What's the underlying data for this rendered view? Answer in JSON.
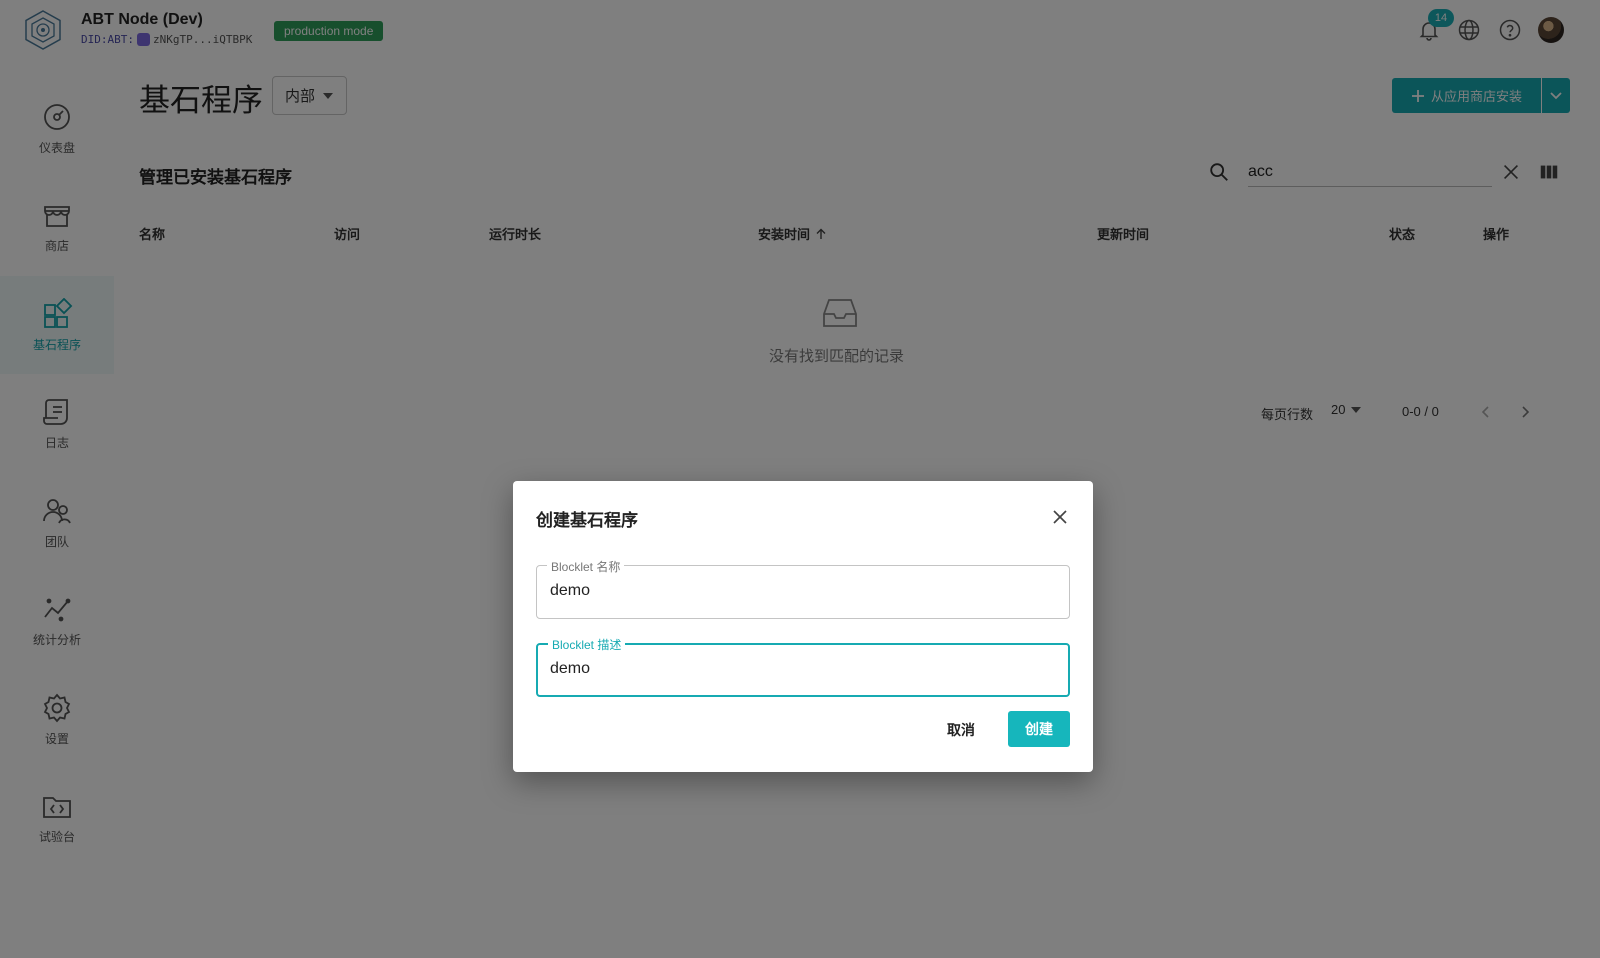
{
  "header": {
    "app_title": "ABT Node (Dev)",
    "did_prefix": "DID:ABT:",
    "did_value": "zNKgTP...iQTBPK",
    "mode_badge": "production mode",
    "notification_count": "14"
  },
  "sidebar": {
    "items": [
      {
        "label": "仪表盘",
        "icon": "dashboard-icon"
      },
      {
        "label": "商店",
        "icon": "store-icon"
      },
      {
        "label": "基石程序",
        "icon": "blocklets-icon",
        "active": true
      },
      {
        "label": "日志",
        "icon": "logs-icon"
      },
      {
        "label": "团队",
        "icon": "team-icon"
      },
      {
        "label": "统计分析",
        "icon": "analytics-icon"
      },
      {
        "label": "设置",
        "icon": "settings-icon"
      },
      {
        "label": "试验台",
        "icon": "playground-icon"
      }
    ]
  },
  "main": {
    "title": "基石程序",
    "scope_select": "内部",
    "install_button": "从应用商店安装",
    "section_title": "管理已安装基石程序",
    "search_value": "acc",
    "columns": [
      "名称",
      "访问",
      "运行时长",
      "安装时间",
      "更新时间",
      "状态",
      "操作"
    ],
    "sorted_column": "安装时间",
    "empty_text": "没有找到匹配的记录",
    "pagination": {
      "rows_per_page_label": "每页行数",
      "rows_per_page": "20",
      "range": "0-0 / 0"
    }
  },
  "dialog": {
    "title": "创建基石程序",
    "name_label": "Blocklet 名称",
    "name_value": "demo",
    "desc_label": "Blocklet 描述",
    "desc_value": "demo",
    "cancel_label": "取消",
    "create_label": "创建"
  },
  "colors": {
    "accent": "#16aab2",
    "badge_green": "#2e9e5b",
    "overlay": "rgba(0,0,0,0.5)"
  }
}
